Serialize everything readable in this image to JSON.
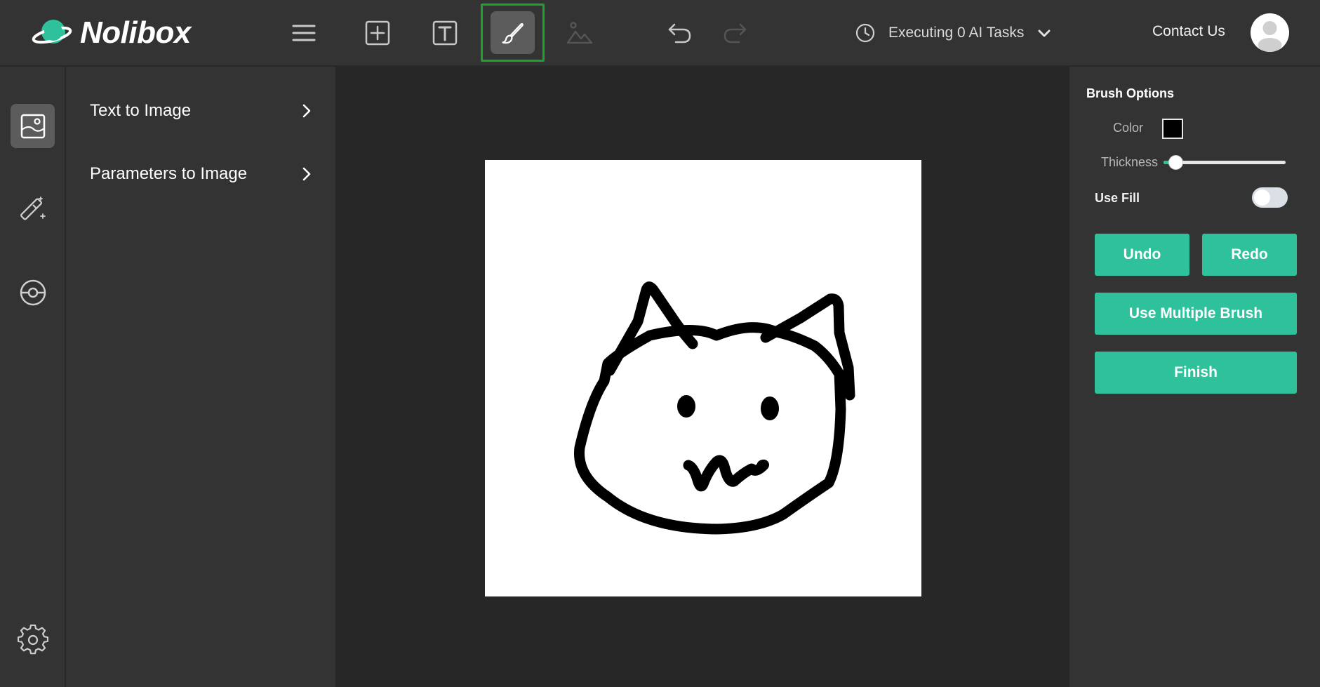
{
  "app": {
    "name": "Nolibox",
    "colors": {
      "accent": "#2ec19b",
      "active_outline": "#1fa02f",
      "bar": "#333333",
      "canvas_bg": "#272727"
    }
  },
  "toolbar": {
    "tools": [
      "menu-icon",
      "add-box-icon",
      "text-box-icon",
      "brush-icon",
      "image-icon",
      "undo-icon",
      "redo-icon"
    ],
    "active_tool": "brush-icon",
    "tasks_label": "Executing 0 AI Tasks",
    "contact_label": "Contact Us"
  },
  "rail": {
    "items": [
      "image-panel-icon",
      "magic-wand-icon",
      "plugin-icon"
    ],
    "active": "image-panel-icon",
    "bottom": "settings-icon"
  },
  "sidepanel": {
    "items": [
      {
        "label": "Text to Image"
      },
      {
        "label": "Parameters to Image"
      }
    ]
  },
  "brush_options": {
    "title": "Brush Options",
    "color_label": "Color",
    "color_value": "#000000",
    "thickness_label": "Thickness",
    "thickness_fraction": 0.1,
    "use_fill_label": "Use Fill",
    "use_fill": false,
    "buttons": {
      "undo": "Undo",
      "redo": "Redo",
      "multiple": "Use Multiple Brush",
      "finish": "Finish"
    }
  }
}
